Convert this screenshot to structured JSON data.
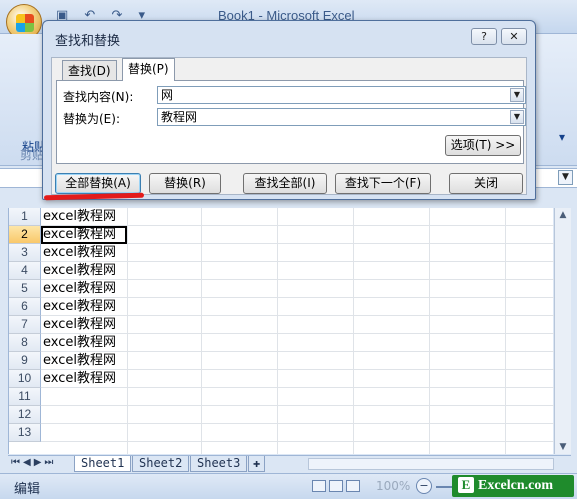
{
  "window": {
    "title": "Book1 - Microsoft Excel",
    "quick_access": "▣ ↶ ↷ ▾"
  },
  "ribbon": {
    "paste_label": "粘贴",
    "clipboard_group": "剪贴",
    "right_fragment": "▾"
  },
  "dialog": {
    "title": "查找和替换",
    "help_label": "?",
    "close_label": "✕",
    "tabs": [
      {
        "label": "查找(D)",
        "active": false
      },
      {
        "label": "替换(P)",
        "active": true
      }
    ],
    "find_label": "查找内容(N):",
    "find_value": "网",
    "replace_label": "替换为(E):",
    "replace_value": "教程网",
    "options_button": "选项(T) >>",
    "buttons": {
      "replace_all": "全部替换(A)",
      "replace": "替换(R)",
      "find_all": "查找全部(I)",
      "find_next": "查找下一个(F)",
      "close": "关闭"
    }
  },
  "sheet": {
    "row_numbers": [
      "1",
      "2",
      "3",
      "4",
      "5",
      "6",
      "7",
      "8",
      "9",
      "10",
      "11",
      "12",
      "13"
    ],
    "active_row": "2",
    "cells": [
      "excel教程网",
      "excel教程网",
      "excel教程网",
      "excel教程网",
      "excel教程网",
      "excel教程网",
      "excel教程网",
      "excel教程网",
      "excel教程网",
      "excel教程网"
    ],
    "tabs": [
      {
        "label": "Sheet1",
        "active": true
      },
      {
        "label": "Sheet2",
        "active": false
      },
      {
        "label": "Sheet3",
        "active": false
      }
    ]
  },
  "status": {
    "mode": "编辑",
    "zoom": "100%",
    "zoom_minus": "−"
  },
  "watermark": {
    "letter": "E",
    "text": "Excelcn.com"
  }
}
